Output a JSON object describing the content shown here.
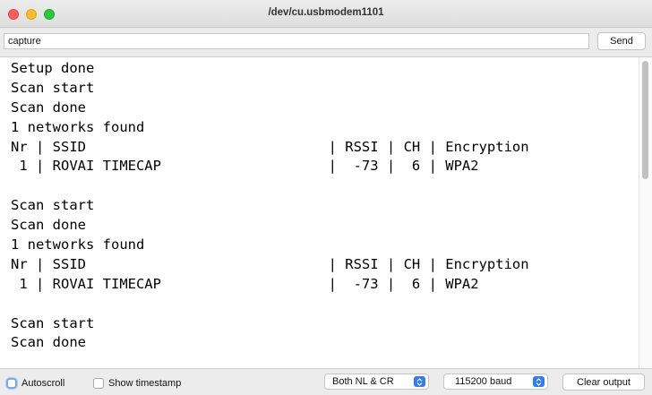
{
  "window": {
    "title": "/dev/cu.usbmodem1101"
  },
  "input": {
    "value": "capture",
    "send_label": "Send"
  },
  "output": {
    "lines": [
      "Setup done",
      "Scan start",
      "Scan done",
      "1 networks found",
      "Nr | SSID                             | RSSI | CH | Encryption",
      " 1 | ROVAI TIMECAP                    |  -73 |  6 | WPA2",
      "",
      "Scan start",
      "Scan done",
      "1 networks found",
      "Nr | SSID                             | RSSI | CH | Encryption",
      " 1 | ROVAI TIMECAP                    |  -73 |  6 | WPA2",
      "",
      "Scan start",
      "Scan done"
    ]
  },
  "status": {
    "autoscroll_label": "Autoscroll",
    "timestamp_label": "Show timestamp",
    "line_ending": "Both NL & CR",
    "baud": "115200 baud",
    "clear_label": "Clear output"
  },
  "colors": {
    "accent": "#2f7cf6"
  }
}
